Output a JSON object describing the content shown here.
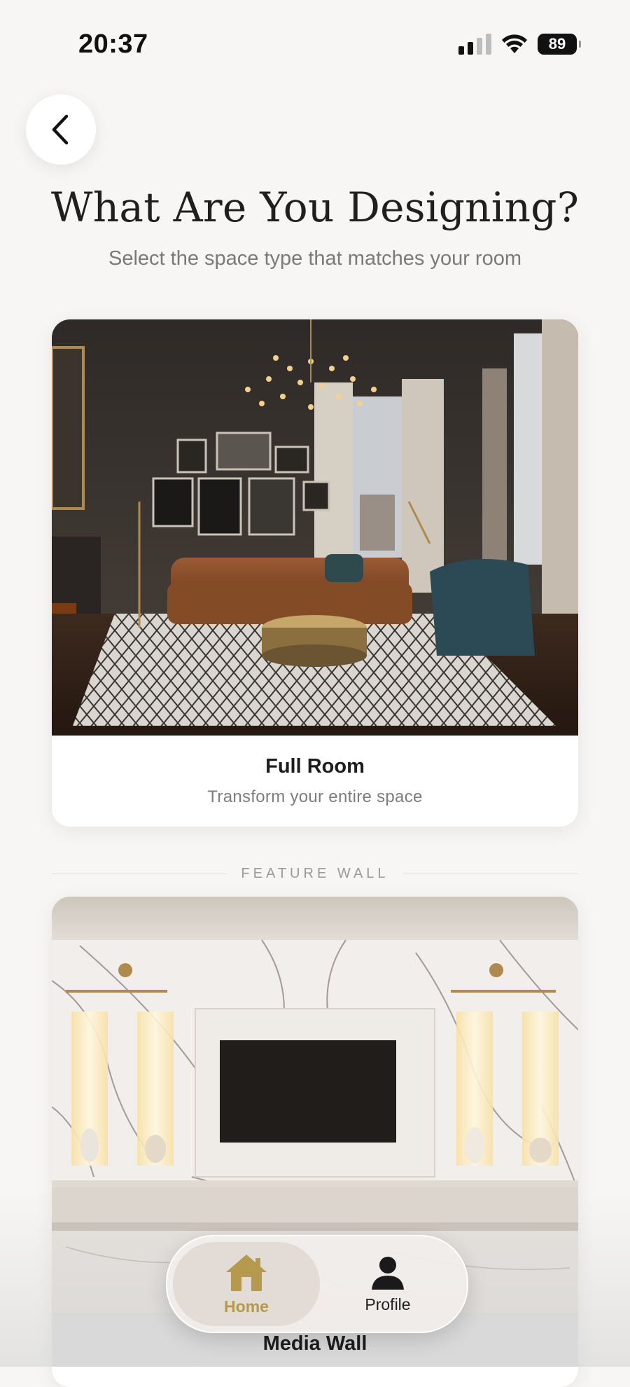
{
  "status_bar": {
    "time": "20:37",
    "battery": "89"
  },
  "header": {
    "title": "What Are You Designing?",
    "subtitle": "Select the space type that matches your room"
  },
  "cards": [
    {
      "label": "Full Room",
      "description": "Transform your entire space",
      "image_icon": "living-room-photo"
    },
    {
      "label": "Media Wall",
      "image_icon": "marble-media-wall-photo"
    }
  ],
  "section_divider": {
    "label": "FEATURE WALL"
  },
  "tab_bar": {
    "home_label": "Home",
    "profile_label": "Profile",
    "active_color": "#b59a4d"
  },
  "colors": {
    "background": "#f7f6f4",
    "accent_gold": "#b59a4d"
  }
}
